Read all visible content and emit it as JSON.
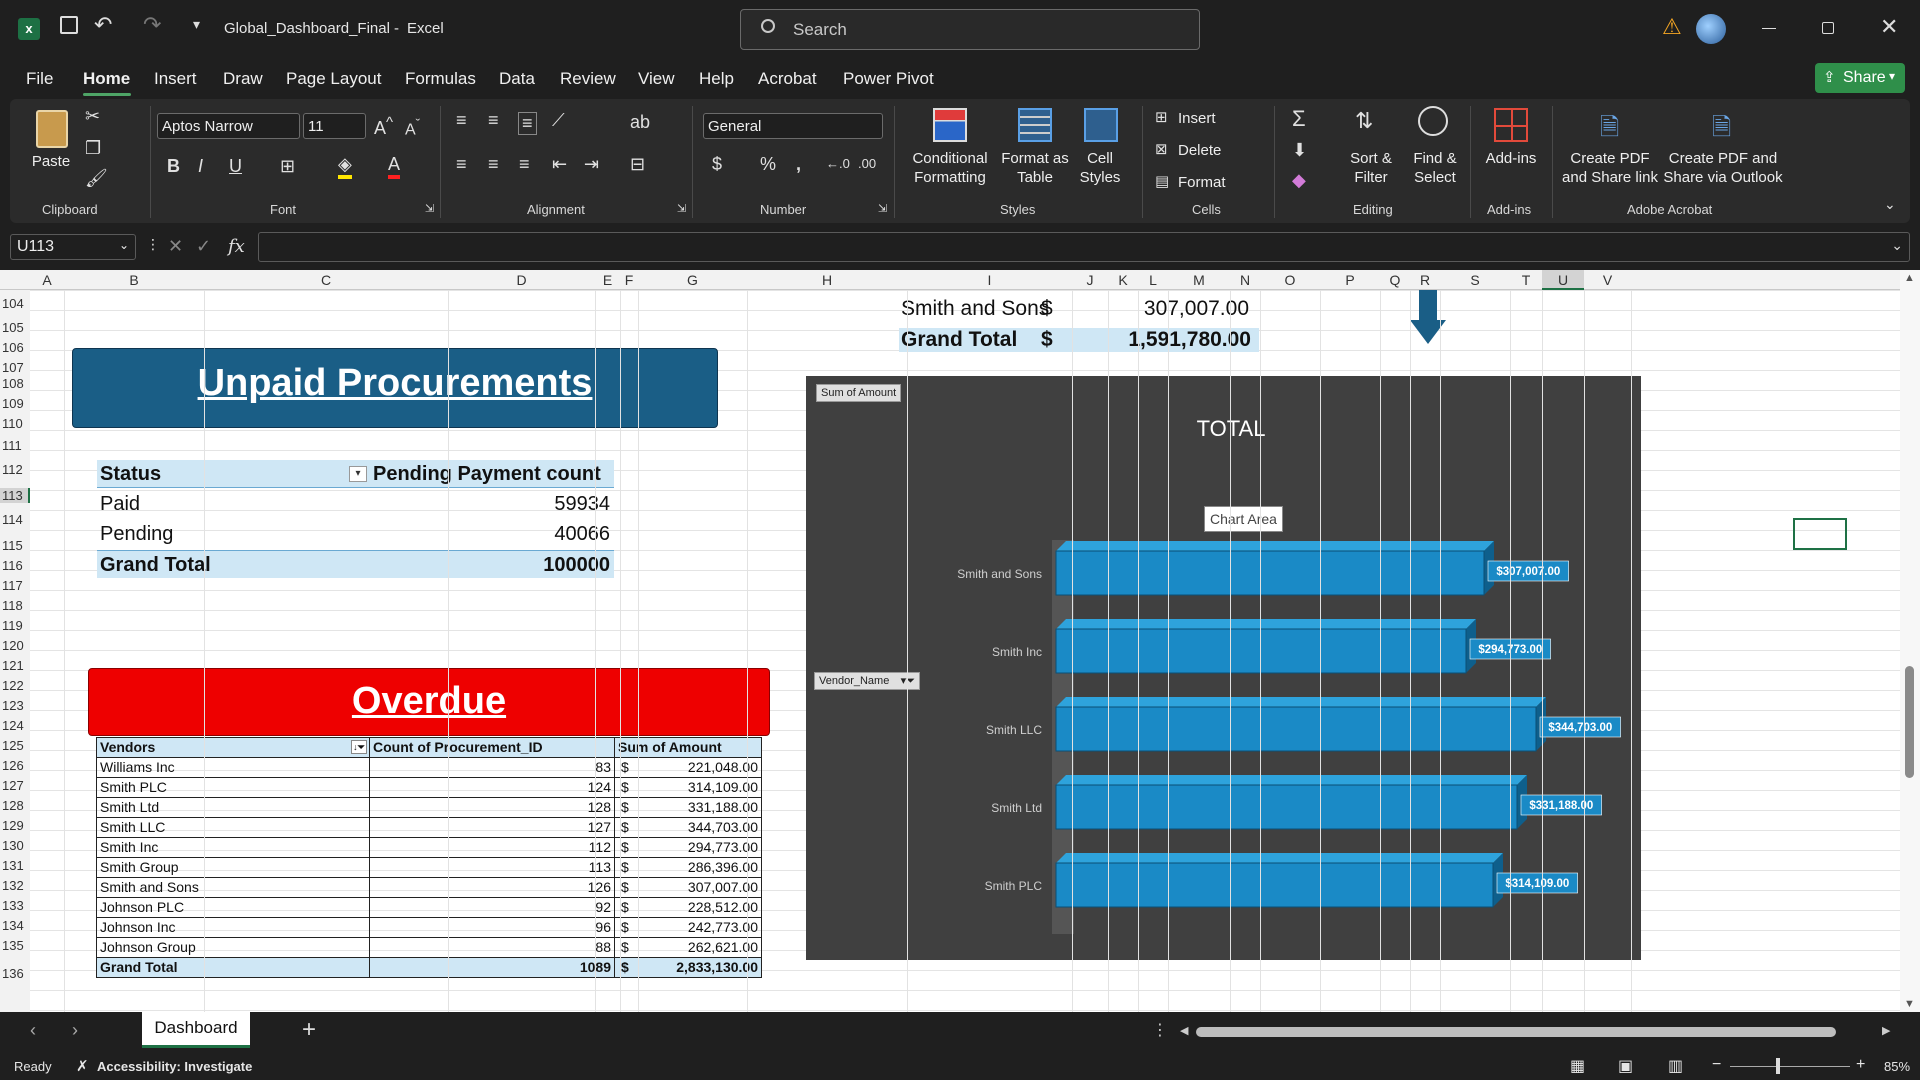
{
  "titlebar": {
    "doc_title": "Global_Dashboard_Final",
    "sep": "-",
    "app": "Excel",
    "search_placeholder": "Search"
  },
  "menu": [
    "File",
    "Home",
    "Insert",
    "Draw",
    "Page Layout",
    "Formulas",
    "Data",
    "Review",
    "View",
    "Help",
    "Acrobat",
    "Power Pivot"
  ],
  "share_label": "Share",
  "ribbon": {
    "clipboard": {
      "paste": "Paste",
      "label": "Clipboard"
    },
    "font": {
      "name": "Aptos Narrow",
      "size": "11",
      "label": "Font"
    },
    "alignment": {
      "label": "Alignment"
    },
    "number": {
      "format": "General",
      "label": "Number"
    },
    "styles": {
      "conditional": "Conditional Formatting",
      "format_table": "Format as Table",
      "cell_styles": "Cell Styles",
      "label": "Styles"
    },
    "cells": {
      "insert": "Insert",
      "delete": "Delete",
      "format": "Format",
      "label": "Cells"
    },
    "editing": {
      "sort": "Sort & Filter",
      "find": "Find & Select",
      "label": "Editing"
    },
    "addins": {
      "btn": "Add-ins",
      "label": "Add-ins"
    },
    "acrobat": {
      "pdf_link": "Create PDF and Share link",
      "pdf_outlook": "Create PDF and Share via Outlook",
      "label": "Adobe Acrobat"
    }
  },
  "formula_bar": {
    "name_box": "U113",
    "formula": ""
  },
  "columns": [
    "A",
    "B",
    "C",
    "D",
    "E",
    "F",
    "G",
    "H",
    "I",
    "J",
    "K",
    "L",
    "M",
    "N",
    "O",
    "P",
    "Q",
    "R",
    "S",
    "T",
    "U",
    "V"
  ],
  "rows": [
    "104",
    "105",
    "106",
    "107",
    "108",
    "109",
    "110",
    "111",
    "112",
    "113",
    "114",
    "115",
    "116",
    "117",
    "118",
    "119",
    "120",
    "121",
    "122",
    "123",
    "124",
    "125",
    "126",
    "127",
    "128",
    "129",
    "130",
    "131",
    "132",
    "133",
    "134",
    "135",
    "136"
  ],
  "top_table": {
    "row1": {
      "vendor": "Smith and Sons",
      "cur": "$",
      "amount": "307,007.00"
    },
    "row2": {
      "vendor": "Grand Total",
      "cur": "$",
      "amount": "1,591,780.00"
    }
  },
  "unpaid": {
    "title": "Unpaid Procurements",
    "headers": [
      "Status",
      "Pending Payment count"
    ],
    "rows": [
      {
        "status": "Paid",
        "count": "59934"
      },
      {
        "status": "Pending",
        "count": "40066"
      }
    ],
    "total": {
      "label": "Grand Total",
      "count": "100000"
    }
  },
  "overdue": {
    "title": "Overdue",
    "headers": [
      "Vendors",
      "Count of Procurement_ID",
      "Sum of Amount"
    ],
    "rows": [
      {
        "vendor": "Williams Inc",
        "count": "83",
        "cur": "$",
        "amount": "221,048.00"
      },
      {
        "vendor": "Smith PLC",
        "count": "124",
        "cur": "$",
        "amount": "314,109.00"
      },
      {
        "vendor": "Smith Ltd",
        "count": "128",
        "cur": "$",
        "amount": "331,188.00"
      },
      {
        "vendor": "Smith LLC",
        "count": "127",
        "cur": "$",
        "amount": "344,703.00"
      },
      {
        "vendor": "Smith Inc",
        "count": "112",
        "cur": "$",
        "amount": "294,773.00"
      },
      {
        "vendor": "Smith Group",
        "count": "113",
        "cur": "$",
        "amount": "286,396.00"
      },
      {
        "vendor": "Smith and Sons",
        "count": "126",
        "cur": "$",
        "amount": "307,007.00"
      },
      {
        "vendor": "Johnson PLC",
        "count": "92",
        "cur": "$",
        "amount": "228,512.00"
      },
      {
        "vendor": "Johnson Inc",
        "count": "96",
        "cur": "$",
        "amount": "242,773.00"
      },
      {
        "vendor": "Johnson Group",
        "count": "88",
        "cur": "$",
        "amount": "262,621.00"
      }
    ],
    "total": {
      "label": "Grand Total",
      "count": "1089",
      "cur": "$",
      "amount": "2,833,130.00"
    }
  },
  "chart": {
    "field_button": "Sum of Amount",
    "title": "TOTAL",
    "tooltip": "Chart Area",
    "axis_button": "Vendor_Name",
    "chart_data": {
      "type": "bar",
      "title": "TOTAL",
      "categories": [
        "Smith and Sons",
        "Smith Inc",
        "Smith LLC",
        "Smith Ltd",
        "Smith PLC"
      ],
      "values": [
        307007,
        294773,
        344703,
        331188,
        314109
      ],
      "labels": [
        "$307,007.00",
        "$294,773.00",
        "$344,703.00",
        "$331,188.00",
        "$314,109.00"
      ],
      "bar_color": "#1a8ac6"
    }
  },
  "sheet_tab": "Dashboard",
  "status": {
    "ready": "Ready",
    "accessibility": "Accessibility: Investigate",
    "zoom": "85%"
  },
  "colors": {
    "unpaid_banner": "#1a5e86",
    "overdue_banner": "#ee0000",
    "pivot_header": "#cfe7f5",
    "chart_bg": "#404040",
    "accent": "#2f8f4a"
  }
}
